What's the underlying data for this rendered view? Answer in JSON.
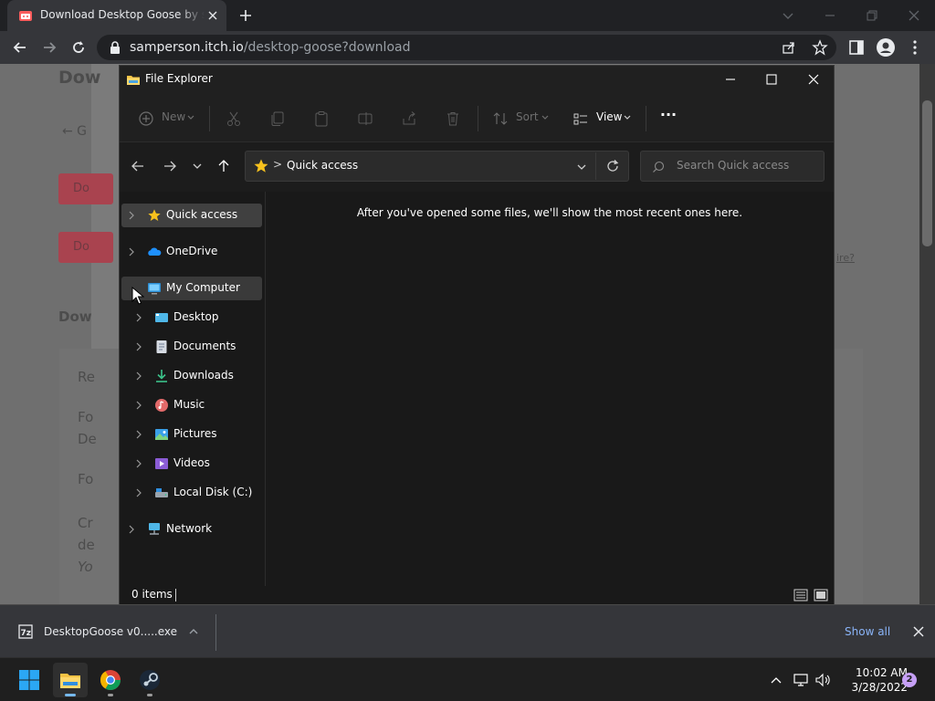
{
  "browser": {
    "tab_title": "Download Desktop Goose by samperson",
    "url_host": "samperson.itch.io",
    "url_path": "/desktop-goose?download"
  },
  "background_page": {
    "heading_fragment": "Dow",
    "back_fragment": "← G",
    "button1_fragment": "Do",
    "button2_fragment": "Do",
    "section_fragment": "Dow",
    "right_fragment": "ire?",
    "card_lines": [
      "Re",
      "Fo",
      "De",
      "Fo",
      "Cr",
      "de",
      "Yo"
    ]
  },
  "file_explorer": {
    "window_title": "File Explorer",
    "commands": {
      "new_label": "New",
      "sort_label": "Sort",
      "view_label": "View",
      "more_label": "···"
    },
    "address": {
      "location": "Quick access",
      "separator": ">"
    },
    "search_placeholder": "Search Quick access",
    "nav_tree": {
      "quick_access": "Quick access",
      "onedrive": "OneDrive",
      "my_computer": "My Computer",
      "children": [
        "Desktop",
        "Documents",
        "Downloads",
        "Music",
        "Pictures",
        "Videos",
        "Local Disk (C:)"
      ],
      "network": "Network"
    },
    "empty_message": "After you've opened some files, we'll show the most recent ones here.",
    "status": "0 items"
  },
  "download_bar": {
    "file_name": "DesktopGoose v0.....exe",
    "show_all": "Show all"
  },
  "taskbar": {
    "time": "10:02 AM",
    "date": "3/28/2022",
    "notification_count": "2"
  },
  "colors": {
    "chrome_dark": "#202124",
    "chrome_toolbar": "#35363a",
    "explorer_bg": "#191919",
    "accent_link": "#8ab4f8",
    "itch_button": "#a9434f"
  }
}
